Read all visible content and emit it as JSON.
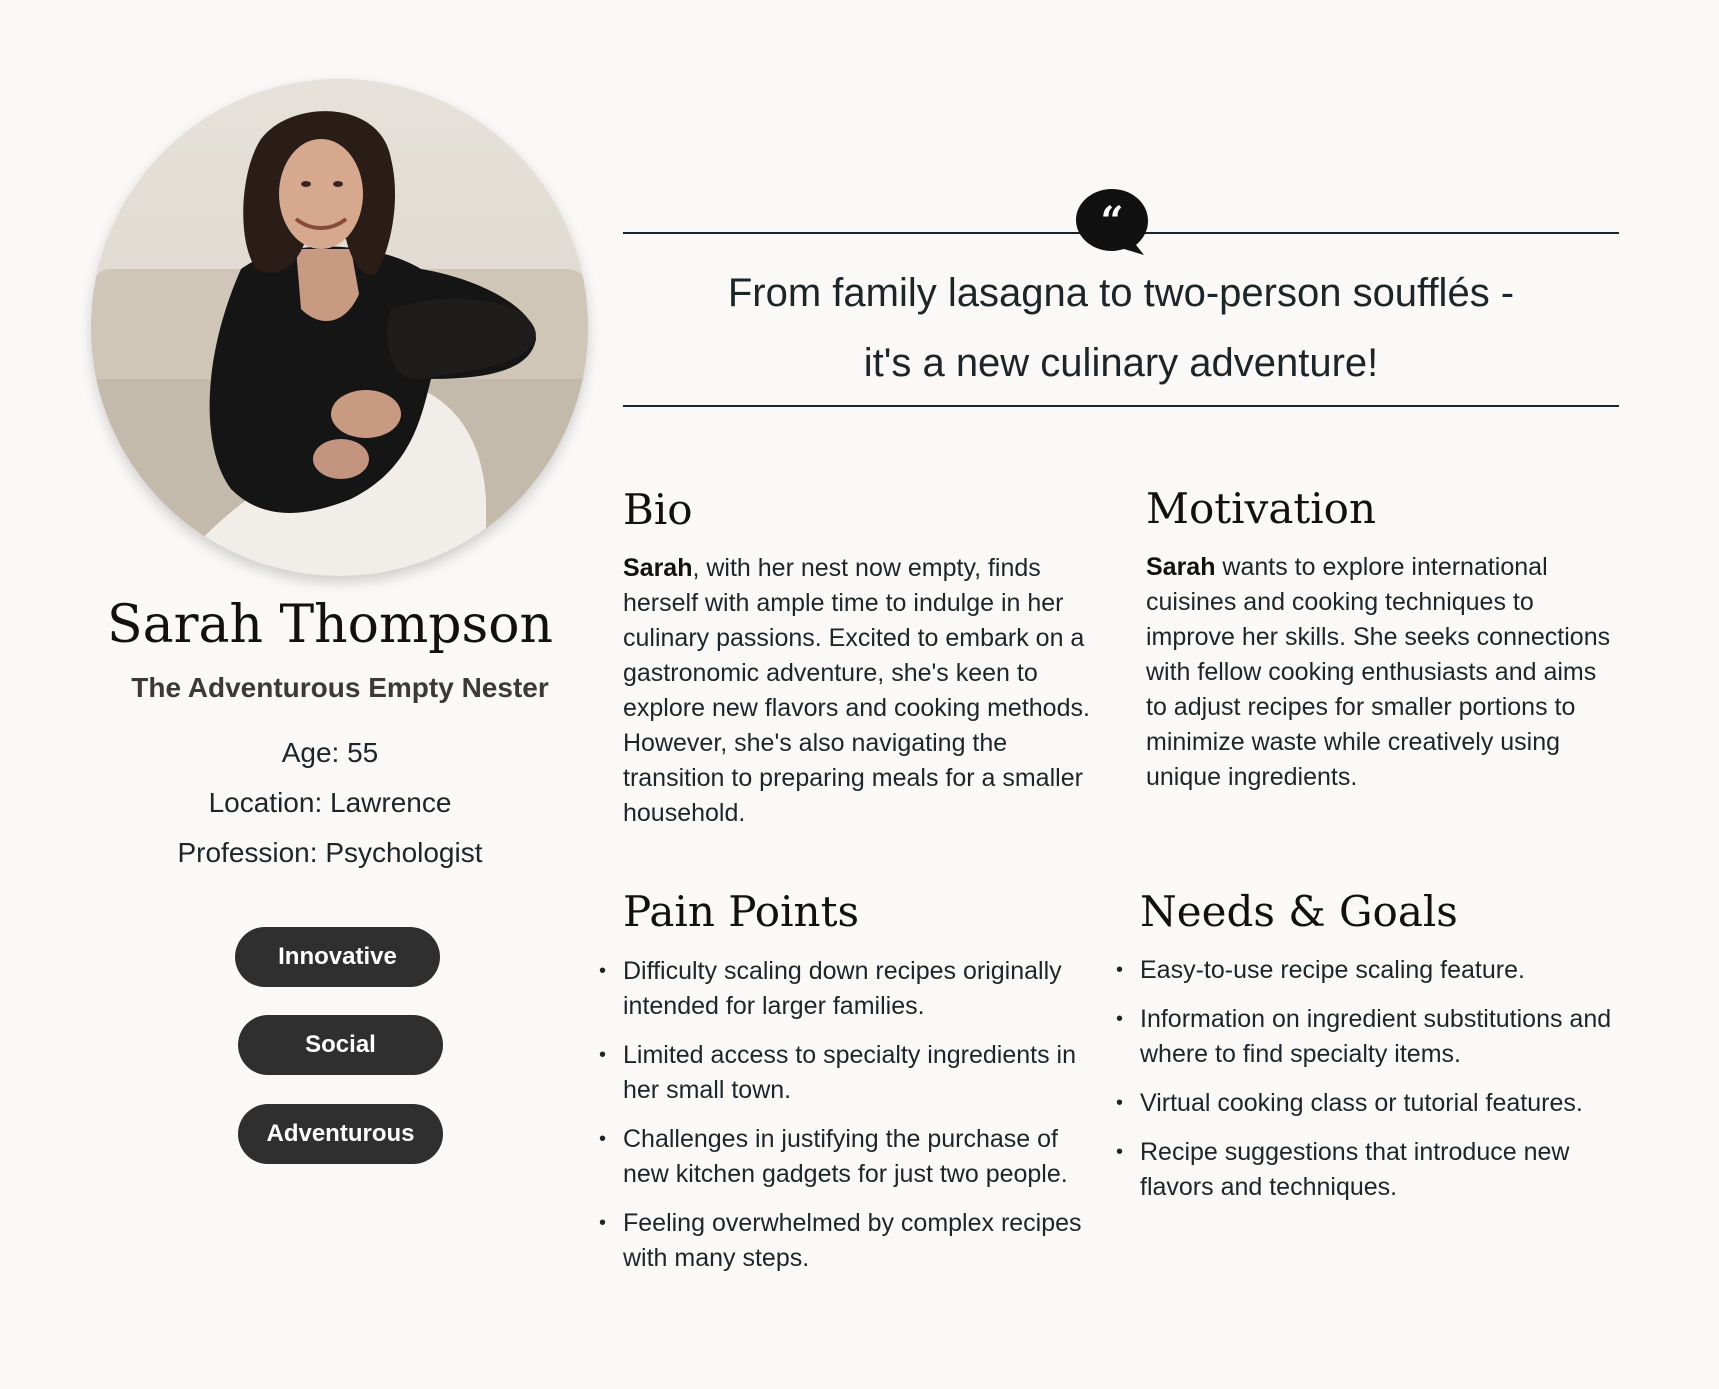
{
  "persona": {
    "name": "Sarah Thompson",
    "subtitle": "The Adventurous Empty Nester",
    "age": "Age: 55",
    "location": "Location: Lawrence",
    "profession": "Profession: Psychologist",
    "tags": [
      "Innovative",
      "Social",
      "Adventurous"
    ],
    "photo_icon": "portrait-photo"
  },
  "quote": {
    "icon": "quote-bubble-icon",
    "line1": "From family lasagna to two-person soufflés -",
    "line2": "it's a new culinary adventure!"
  },
  "bio": {
    "title": "Bio",
    "lead": "Sarah",
    "text": ", with her nest now empty, finds herself with ample time to indulge in her culinary passions. Excited to embark on a gastronomic adventure, she's keen to explore new flavors and cooking methods. However, she's also navigating the transition to preparing meals for a smaller household."
  },
  "motivation": {
    "title": "Motivation",
    "lead": "Sarah",
    "text": " wants to explore international cuisines and cooking techniques to improve her skills. She seeks connections with fellow cooking enthusiasts and aims to adjust recipes for smaller portions to minimize waste while creatively using unique ingredients."
  },
  "pain_points": {
    "title": "Pain Points",
    "items": [
      "Difficulty scaling down recipes originally intended for larger families.",
      "Limited access to specialty ingredients in her small town.",
      "Challenges in justifying the purchase of new kitchen gadgets for just two people.",
      "Feeling overwhelmed by complex recipes with many steps."
    ]
  },
  "needs_goals": {
    "title": "Needs & Goals",
    "items": [
      "Easy-to-use recipe scaling feature.",
      "Information on ingredient substitutions and where to find specialty items.",
      "Virtual cooking class or tutorial features.",
      "Recipe suggestions that introduce new flavors and techniques."
    ]
  },
  "colors": {
    "background": "#faf9f8",
    "tag_background": "#2f2f2f",
    "text": "#1d2528"
  }
}
